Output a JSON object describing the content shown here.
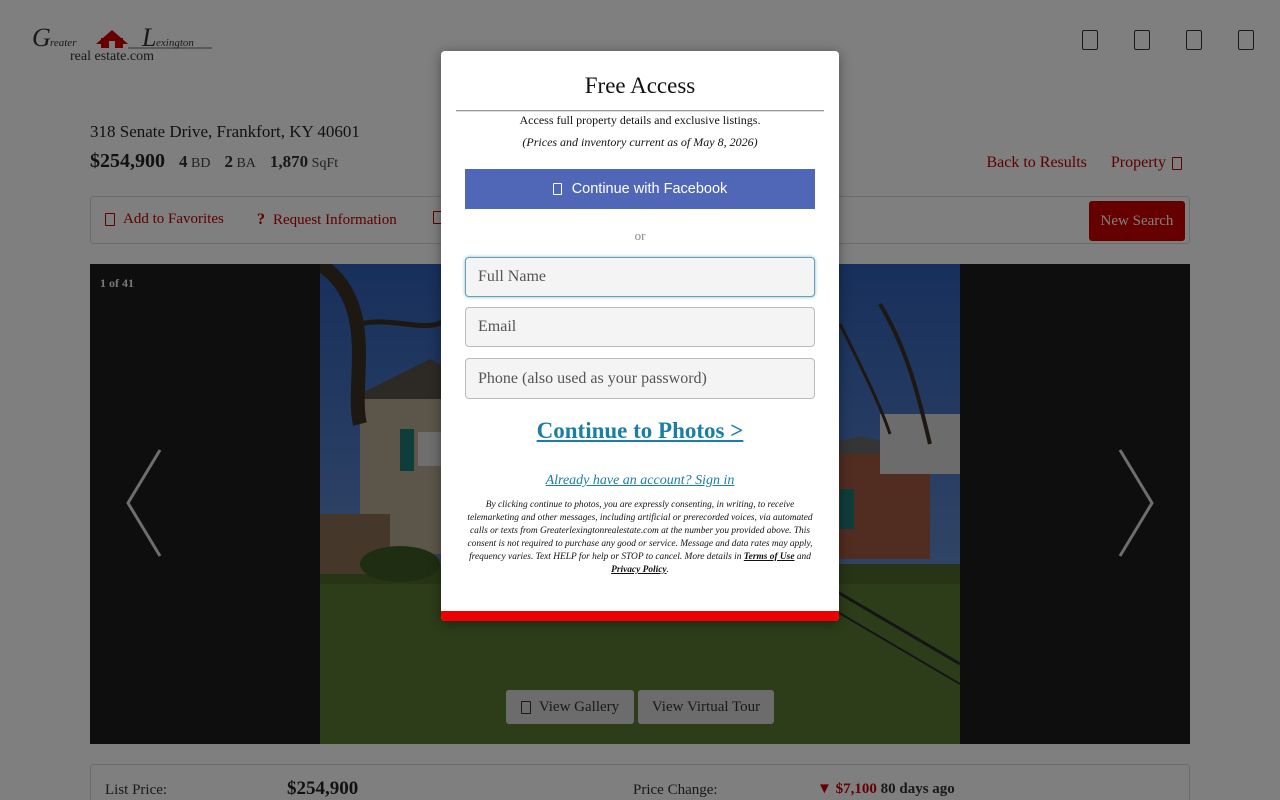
{
  "header": {
    "logo_text": "Greater Lexington real estate.com",
    "icons": [
      "user-icon",
      "heart-icon",
      "search-icon",
      "menu-icon"
    ]
  },
  "listing": {
    "address": "318 Senate Drive, Frankfort, KY 40601",
    "price": "$254,900",
    "beds": "4",
    "beds_label": "BD",
    "baths": "2",
    "baths_label": "BA",
    "sqft": "1,870",
    "sqft_label": "SqFt"
  },
  "nav": {
    "back_to_results": "Back to Results",
    "property": "Property"
  },
  "actions": {
    "add_favorites": "Add to Favorites",
    "request_info": "Request Information",
    "new_search": "New Search"
  },
  "gallery": {
    "counter": "1 of 41",
    "view_gallery": "View Gallery",
    "view_virtual_tour": "View Virtual Tour"
  },
  "details": {
    "list_price_label": "List Price:",
    "list_price_value": "$254,900",
    "price_change_label": "Price Change:",
    "price_change_arrow": "▼",
    "price_change_amount": "$7,100",
    "price_change_when": "80 days ago"
  },
  "modal": {
    "title": "Free Access",
    "subtitle": "Access full property details and exclusive listings.",
    "note": "(Prices and inventory current as of May 8, 2026)",
    "facebook_button": "Continue with Facebook",
    "or": "or",
    "full_name_placeholder": "Full Name",
    "email_placeholder": "Email",
    "phone_placeholder": "Phone (also used as your password)",
    "continue_link": "Continue to Photos >",
    "signin_link": "Already have an account? Sign in",
    "disclaimer_text": "By clicking continue to photos, you are expressly consenting, in writing, to receive telemarketing and other messages, including artificial or prerecorded voices, via automated calls or texts from Greaterlexingtonrealestate.com at the number you provided above. This consent is not required to purchase any good or service. Message and data rates may apply, frequency varies. Text HELP for help or STOP to cancel. More details in",
    "terms_link": "Terms of Use",
    "and": "and",
    "privacy_link": "Privacy Policy",
    "period": ".",
    "colors": {
      "facebook": "#4f67b6",
      "link": "#1b7ea4",
      "accent": "#ee0000"
    }
  }
}
